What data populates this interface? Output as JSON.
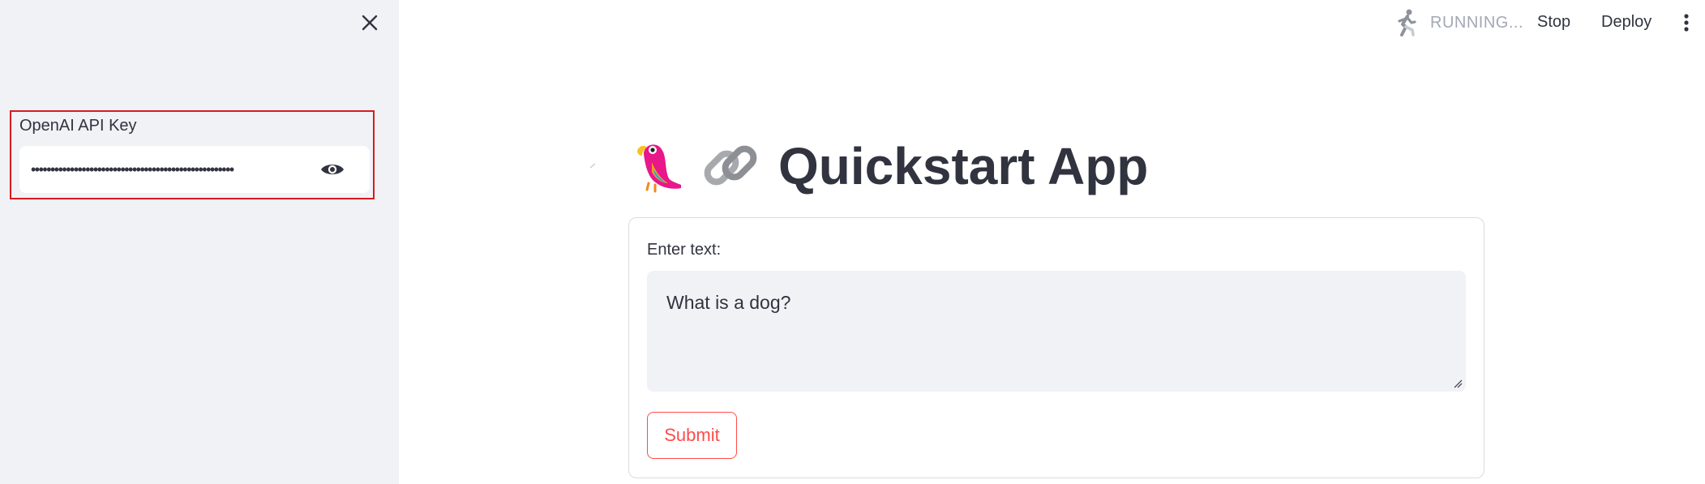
{
  "sidebar": {
    "close_icon": "close-icon",
    "api_key": {
      "label": "OpenAI API Key",
      "masked_value": "••••••••••••••••••••••••••••••••••••••••••••••••••••",
      "toggle_icon": "eye-icon"
    }
  },
  "topbar": {
    "status_icon": "running-man-icon",
    "status_text": "RUNNING...",
    "stop_label": "Stop",
    "deploy_label": "Deploy",
    "menu_icon": "vertical-dots-icon"
  },
  "main": {
    "title": "Quickstart App",
    "title_icons": [
      "parrot-icon",
      "chain-link-icon"
    ],
    "form": {
      "text_label": "Enter text:",
      "text_value": "What is a dog?",
      "submit_label": "Submit"
    }
  },
  "colors": {
    "sidebar_bg": "#f0f2f6",
    "highlight_border": "#d81b20",
    "accent": "#ff4b4b",
    "text": "#31333f",
    "muted": "#a3a8b4"
  }
}
